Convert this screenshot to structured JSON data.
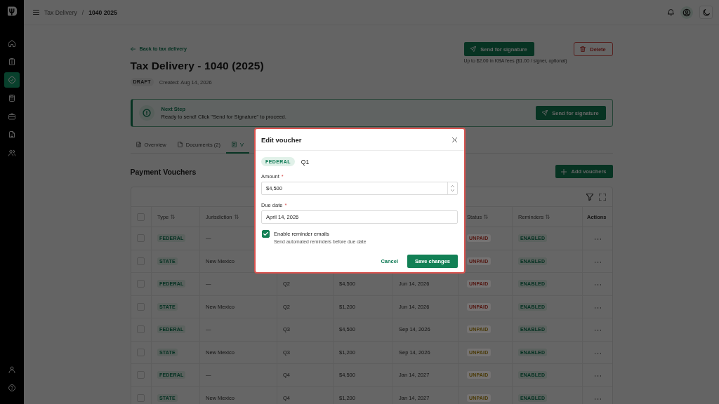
{
  "sidebar": {
    "items": [
      {
        "selected": false
      },
      {
        "selected": false
      },
      {
        "selected": true
      },
      {
        "selected": false
      },
      {
        "selected": false
      },
      {
        "selected": false
      },
      {
        "selected": false
      }
    ],
    "bottom_items": [
      {
        "selected": false
      },
      {
        "selected": false
      }
    ]
  },
  "top_bar": {
    "breadcrumb": {
      "parent": "Tax Delivery",
      "separator": "/",
      "current": "1040 2025"
    }
  },
  "header": {
    "back_link": "Back to tax delivery",
    "title": "Tax Delivery - 1040 (2025)",
    "status_badge": "DRAFT",
    "created": "Created: Aug 14, 2026",
    "send_button": "Send for signature",
    "fee_note": "Up to $2.00 in KBA fees ($1.00 / signer, optional)",
    "delete_button": "Delete"
  },
  "banner": {
    "title": "Next Step",
    "message": "Ready to send! Click \"Send for Signature\" to proceed.",
    "button": "Send for signature"
  },
  "tabs": [
    {
      "label": "Overview",
      "selected": false
    },
    {
      "label": "Documents (2)",
      "selected": false
    },
    {
      "label": "V",
      "selected": true
    }
  ],
  "section": {
    "title": "Payment Vouchers",
    "add_button": "Add vouchers"
  },
  "table": {
    "select_all": false,
    "columns": [
      {
        "label": "Type",
        "sortable": true
      },
      {
        "label": "Jurisdiction",
        "sortable": true
      },
      null,
      null,
      null,
      {
        "label": "Status",
        "sortable": true
      },
      {
        "label": "Reminders",
        "sortable": true
      },
      {
        "label": "Actions",
        "sortable": false
      }
    ],
    "rows": [
      {
        "selected": false,
        "type": "FEDERAL",
        "jurisdiction": "—",
        "status": "UNPAID",
        "color": "#53150f",
        "reminders": "ENABLED"
      },
      {
        "selected": false,
        "type": "STATE",
        "jurisdiction": "New Mexico",
        "status": "UNPAID",
        "color": "#53150f",
        "reminders": "ENABLED"
      },
      {
        "selected": false,
        "type": "FEDERAL",
        "jurisdiction": "—",
        "quarter": "Q2",
        "amount": "$4,500",
        "due_date": "Jun 14, 2026",
        "status": "UNPAID",
        "color": "#53150f",
        "reminders": "ENABLED"
      },
      {
        "selected": false,
        "type": "STATE",
        "jurisdiction": "New Mexico",
        "quarter": "Q2",
        "amount": "$1,200",
        "due_date": "Jun 14, 2026",
        "status": "UNPAID",
        "color": "#53150f",
        "reminders": "ENABLED"
      },
      {
        "selected": false,
        "type": "FEDERAL",
        "jurisdiction": "—",
        "quarter": "Q3",
        "amount": "$4,500",
        "due_date": "Sep 14, 2026",
        "status": "UNPAID",
        "color": "#4a3a06",
        "reminders": "ENABLED"
      },
      {
        "selected": false,
        "type": "STATE",
        "jurisdiction": "New Mexico",
        "quarter": "Q3",
        "amount": "$1,200",
        "due_date": "Sep 14, 2026",
        "status": "UNPAID",
        "color": "#4a3a06",
        "reminders": "ENABLED"
      },
      {
        "selected": false,
        "type": "FEDERAL",
        "jurisdiction": "—",
        "quarter": "Q4",
        "amount": "$4,500",
        "due_date": "Jan 14, 2027",
        "status": "UNPAID",
        "color": "#4a3a06",
        "reminders": "ENABLED"
      },
      {
        "selected": false,
        "type": "STATE",
        "jurisdiction": "New Mexico",
        "quarter": "Q4",
        "amount": "$1,200",
        "due_date": "Jan 14, 2027",
        "status": "UNPAID",
        "color": "#4a3a06",
        "reminders": "ENABLED"
      }
    ]
  },
  "modal": {
    "highlighted": true,
    "title": "Edit voucher",
    "type_badge": "FEDERAL",
    "quarter": "Q1",
    "fields": [
      {
        "kind": "number",
        "label": "Amount",
        "required_mark": "*",
        "value": "$4,500"
      },
      {
        "kind": "date",
        "label": "Due date",
        "required_mark": "*",
        "value": "April 14, 2026"
      }
    ],
    "reminder": {
      "label": "Enable reminder emails",
      "hint": "Send automated reminders before due date",
      "checked": true
    },
    "cancel_button": "Cancel",
    "save_button": "Save changes"
  }
}
